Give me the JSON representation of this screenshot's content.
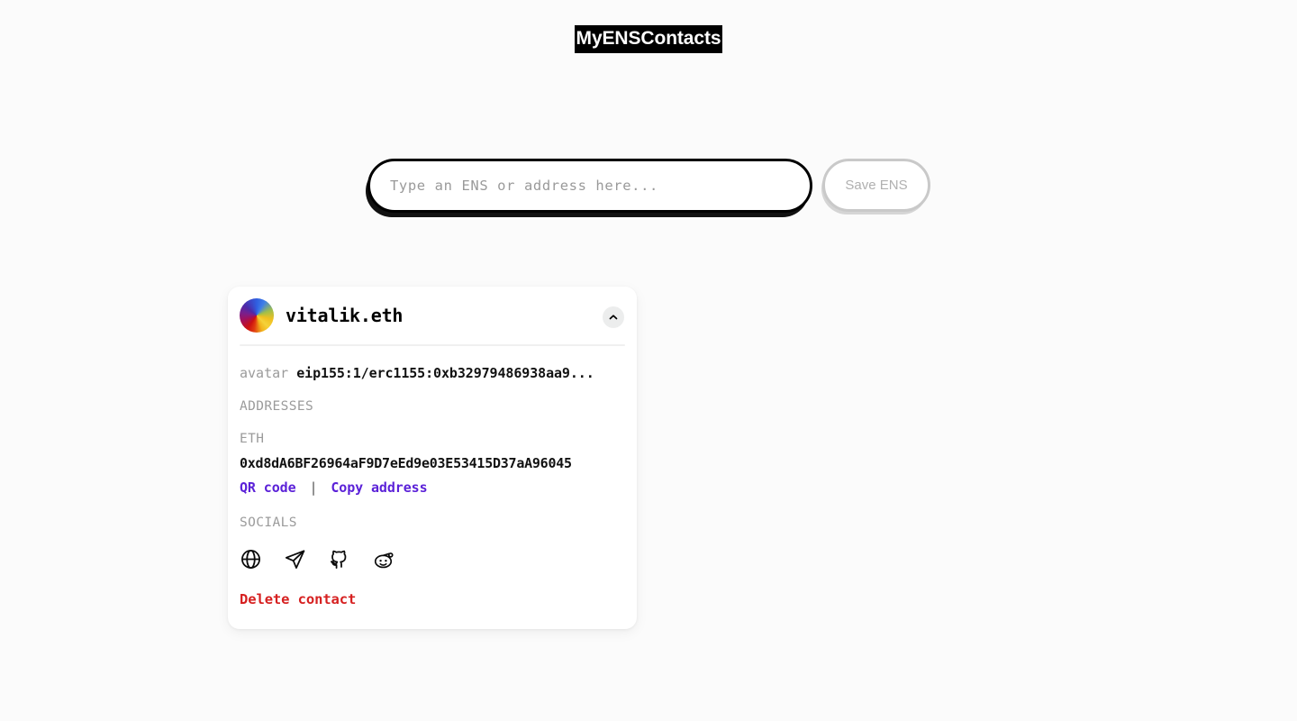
{
  "app": {
    "title": "MyENSContacts",
    "background_color": "#fbfbfb"
  },
  "search": {
    "placeholder": "Type an ENS or address here...",
    "value": "",
    "save_button_label": "Save ENS",
    "save_button_disabled": true,
    "border_color": "#000000"
  },
  "contact": {
    "name": "vitalik.eth",
    "avatar_icon": "gradient-circle-avatar",
    "collapse_icon": "chevron-up-icon",
    "records": [
      {
        "key": "avatar",
        "value": "eip155:1/erc1155:0xb32979486938aa9..."
      }
    ],
    "addresses_label": "ADDRESSES",
    "addresses": [
      {
        "coin": "ETH",
        "address": "0xd8dA6BF26964aF9D7eEd9e03E53415D37aA96045",
        "qr_label": "QR code",
        "separator": "|",
        "copy_label": "Copy address"
      }
    ],
    "socials_label": "SOCIALS",
    "socials": [
      {
        "name": "website-icon",
        "title": "Website"
      },
      {
        "name": "telegram-icon",
        "title": "Telegram"
      },
      {
        "name": "github-icon",
        "title": "GitHub"
      },
      {
        "name": "reddit-icon",
        "title": "Reddit"
      }
    ],
    "delete_label": "Delete contact",
    "link_color": "#5b21d8",
    "delete_color": "#d62020"
  }
}
